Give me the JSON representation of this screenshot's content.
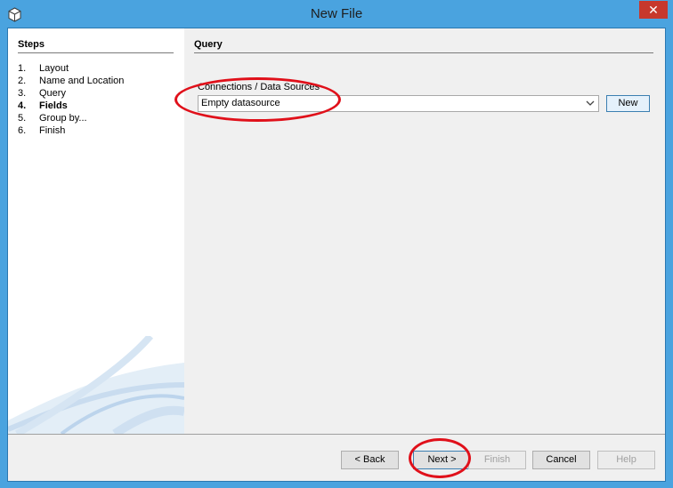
{
  "window": {
    "title": "New File",
    "close_glyph": "✕"
  },
  "steps": {
    "header": "Steps",
    "items": [
      {
        "num": "1.",
        "label": "Layout"
      },
      {
        "num": "2.",
        "label": "Name and Location"
      },
      {
        "num": "3.",
        "label": "Query"
      },
      {
        "num": "4.",
        "label": "Fields"
      },
      {
        "num": "5.",
        "label": "Group by..."
      },
      {
        "num": "6.",
        "label": "Finish"
      }
    ],
    "current_index": 3
  },
  "query": {
    "header": "Query",
    "connections_label": "Connections / Data Sources",
    "datasource_value": "Empty datasource",
    "new_button": "New"
  },
  "footer": {
    "back": "< Back",
    "next": "Next >",
    "finish": "Finish",
    "cancel": "Cancel",
    "help": "Help"
  },
  "colors": {
    "accent": "#4aa3df",
    "annotation": "#e0101a"
  }
}
